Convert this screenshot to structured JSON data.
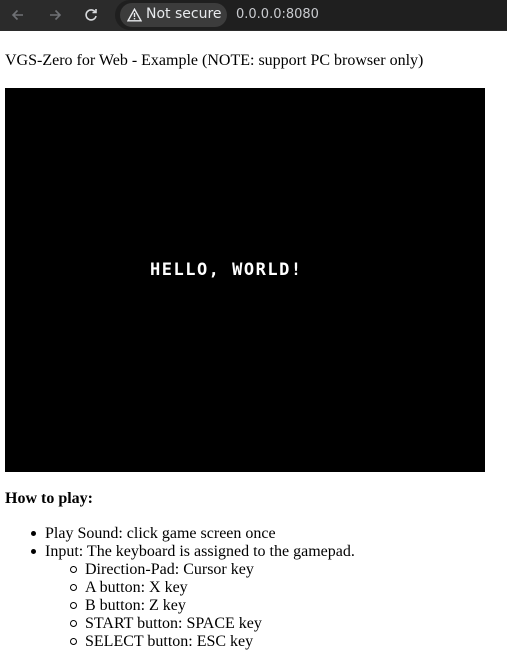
{
  "browser": {
    "security_label": "Not secure",
    "url": "0.0.0.0:8080",
    "icons": [
      "back-arrow-icon",
      "forward-arrow-icon",
      "reload-icon",
      "warning-icon"
    ]
  },
  "page": {
    "title": "VGS-Zero for Web - Example (NOTE: support PC browser only)",
    "game_screen_text": "HELLO, WORLD!",
    "howto_heading": "How to play:",
    "items": [
      "Play Sound: click game screen once",
      "Input: The keyboard is assigned to the gamepad."
    ],
    "key_mapping": [
      "Direction-Pad: Cursor key",
      "A button: X key",
      "B button: Z key",
      "START button: SPACE key",
      "SELECT button: ESC key"
    ]
  },
  "colors": {
    "toolbar": "#2b2b2b",
    "omnibox": "#1f1f1f",
    "game_background": "#000000"
  }
}
